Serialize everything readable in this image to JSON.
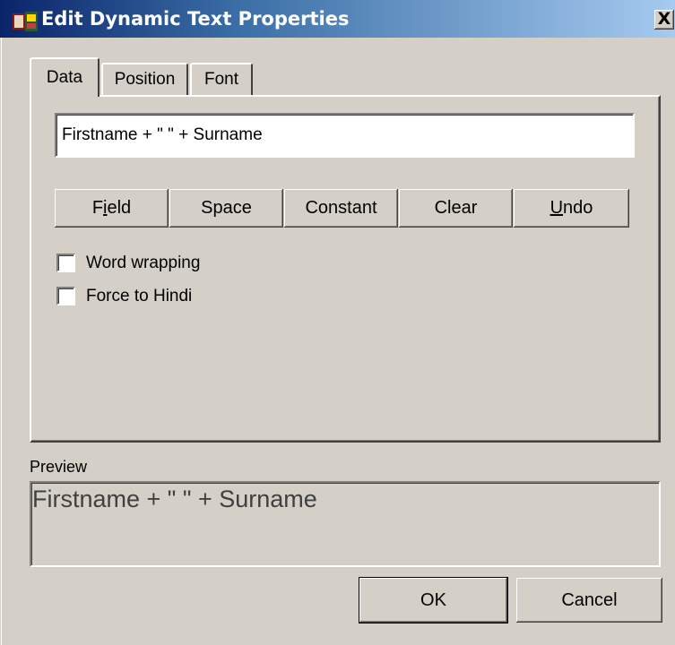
{
  "window": {
    "title": "Edit Dynamic Text Properties",
    "close_symbol": "X",
    "icon": "app-icon"
  },
  "tabs": [
    {
      "label": "Data",
      "selected": true
    },
    {
      "label": "Position",
      "selected": false
    },
    {
      "label": "Font",
      "selected": false
    }
  ],
  "data_tab": {
    "expression_value": "Firstname + \" \" + Surname",
    "buttons": {
      "field_pre": "F",
      "field_mnemonic": "i",
      "field_post": "eld",
      "space": "Space",
      "constant": "Constant",
      "clear": "Clear",
      "undo_mnemonic": "U",
      "undo_post": "ndo"
    },
    "checkboxes": [
      {
        "label": "Word wrapping",
        "checked": false
      },
      {
        "label": "Force to Hindi",
        "checked": false
      }
    ]
  },
  "preview": {
    "label": "Preview",
    "text": "Firstname + \" \" + Surname"
  },
  "footer": {
    "ok": "OK",
    "cancel": "Cancel"
  },
  "colors": {
    "face": "#d4d0c8",
    "title_start": "#0a246a",
    "title_end": "#a6caf0"
  }
}
